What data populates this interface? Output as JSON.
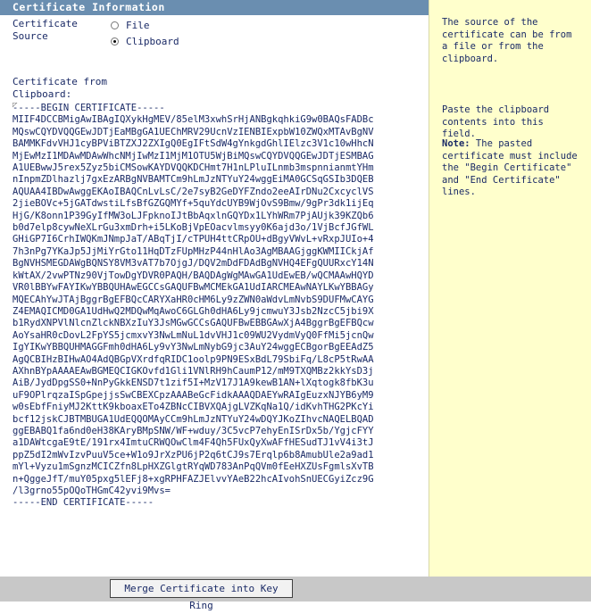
{
  "header": {
    "title": "Certificate Information"
  },
  "source": {
    "label_line1": "Certificate",
    "label_line2": "Source",
    "options": [
      {
        "label": "File",
        "checked": false
      },
      {
        "label": "Clipboard",
        "checked": true
      }
    ]
  },
  "clipboard": {
    "label_line1": "Certificate from",
    "label_line2": "Clipboard:",
    "certificate_text": "-----BEGIN CERTIFICATE-----\nMIIF4DCCBMigAwIBAgIQXykHgMEV/85elM3xwhSrHjANBgkqhkiG9w0BAQsFADBc\nMQswCQYDVQQGEwJDTjEaMBgGA1UEChMRV29UcnVzIENBIExpbW10ZWQxMTAvBgNV\nBAMMKFdvVHJ1cyBPViBTZXJ2ZXIgQ0EgIFtSdW4gYnkgdGhlIElzc3V1c10wHhcN\nMjEwMzI1MDAwMDAwWhcNMjIwMzI1MjM1OTU5WjBiMQswCQYDVQQGEwJDTjESMBAG\nA1UEBwwJ5rex5Zyz5biCMSowKAYDVQQKDCHmt7H1nLPluILnmb3mspnnianmtYHm\nnInpmZDlhazlj7gxEzARBgNVBAMTCm9hLmJzNTYuY24wggEiMA0GCSqGSIb3DQEB\nAQUAA4IBDwAwggEKAoIBAQCnLvLsC/2e7syB2GeDYFZndo2eeAIrDNu2CxcyclVS\n2jieBOVc+5jGATdwstiLfsBfGZGQMYf+5quYdcUYB9WjOvS9Bmw/9gPr3dk1ijEq\nHjG/K8onn1P39GyIfMW3oLJFpknoIJtBbAqxlnGQYDx1LYhWRm7PjAUjk39KZQb6\nb0d7elp8cywNeXLrGu3xmDrh+i5LKoBjVpEOacvlmsyy0K6ajd3o/1VjBcfJGfWL\nGHiGP7I6CrhIWQKmJNmpJaT/ABqTjI/cTPUH4ttCRpOU+dBgyVWvL+vRxpJUIo+4\n7h3nPg7YKaJp5JjMiYrGto11HqDTzFUpMHzP44nHlAo3AgMBAAGjggKWMIICkjAf\nBgNVHSMEGDAWgBQNSY8VM3vAT7b7OjgJ/DQV2mDdFDAdBgNVHQ4EFgQUURxcY14N\nkWtAX/2vwPTNz90VjTowDgYDVR0PAQH/BAQDAgWgMAwGA1UdEwEB/wQCMAAwHQYD\nVR0lBBYwFAYIKwYBBQUHAwEGCCsGAQUFBwMCMEkGA1UdIARCMEAwNAYLKwYBBAGy\nMQECAhYwJTAjBggrBgEFBQcCARYXaHR0cHM6Ly9zZWN0aWdvLmNvbS9DUFMwCAYG\nZ4EMAQICMD0GA1UdHwQ2MDQwMqAwoC6GLGh0dHA6Ly9jcmwuY3Jsb2NzcC5jbi9X\nb1RydXNPVlNlcnZlckNBXzIuY3JsMGwGCCsGAQUFBwEBBGAwXjA4BggrBgEFBQcw\nAoYsaHR0cDovL2FpYS5jcmxvY3NwLmNuL1dvVHJ1c09WU2VydmVyQ0FfMi5jcnQw\nIgYIKwYBBQUHMAGGFmh0dHA6Ly9vY3NwLmNybG9jc3AuY24wggECBgorBgEEAdZ5\nAgQCBIHzBIHwAO4AdQBGpVXrdfqRIDC1oolp9PN9ESxBdL79SbiFq/L8cP5tRwAA\nAXhnBYpAAAAEAwBGMEQCIGKOvfd1Gli1VNlRH9hCaumP12/mM9TXQMBz2kkYsD3j\nAiB/JydDpgSS0+NnPyGkkENSD7t1zif5I+MzV17J1A9kewB1AN+lXqtogk8fbK3u\nuF9OPlrqzaISpGpejjsSwCBEXCpzAAABeGcFidkAAAQDAEYwRAIgEuzxNJYB6yM9\nw0sEbfFniyMJ2KttK9kboaxETo4ZBNcCIBVXQAjgLVZKqNa1Q/idKvhTHG2PKcYi\nbcf12jskCJBTMBUGA1UdEQQOMAyCCm9hLmJzNTYuY24wDQYJKoZIhvcNAQELBQAD\nggEBABQ1fa6nd0eH38KAryBMpSNW/WF+wduy/3C5vcP7ehyEnISrDx5b/YgjcFYY\na1DAWtcgaE9tE/191rx4ImtuCRWQOwClm4F4Qh5FUxQyXwAFfHESudTJ1vV4i3tJ\nppZ5dI2mWvIzvPuuV5ce+W1o9JrXzPU6jP2q6tCJ9s7Erqlp6b8AmubUle2a9ad1\nmYl+Vyzu1mSgnzMCICZfn8LpHXZGlgtRYqWD783AnPqQVm0fEeHXZUsFgmlsXvTB\nn+QggeJfT/muY05pxg5lEFj8+xgRPHFAZJElvvYAeB22hcAIvohSnUECGyiZcz9G\n/l3grno55pOQoTHGmC42yvi9Mvs=\n-----END CERTIFICATE-----"
  },
  "help": {
    "para1": "The source of the certificate can be from a file or from the clipboard.",
    "para2": "Paste the clipboard contents into this field.",
    "note_label": "Note:",
    "note_text": " The pasted certificate must include the \"Begin Certificate\" and \"End Certificate\" lines."
  },
  "footer": {
    "merge_button": "Merge Certificate into Key Ring"
  }
}
